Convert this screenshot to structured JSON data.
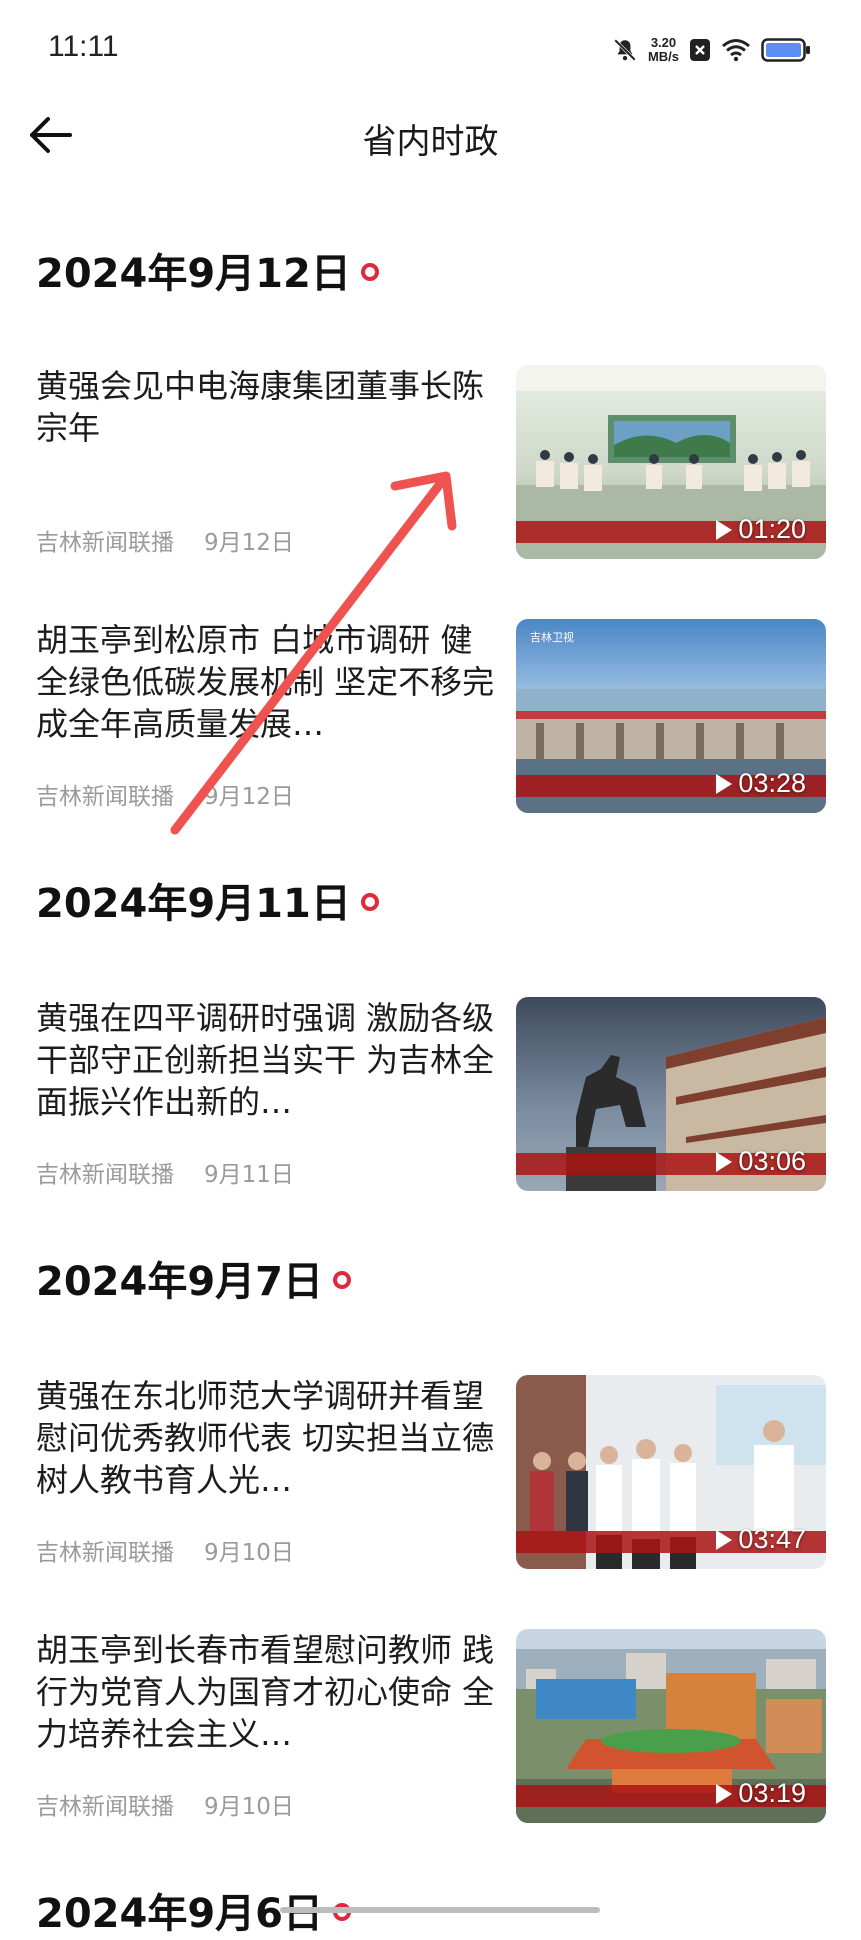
{
  "status_bar": {
    "time": "11:11",
    "net_speed_value": "3.20",
    "net_speed_unit": "MB/s"
  },
  "header": {
    "title": "省内时政",
    "back_icon": "arrow-left-icon"
  },
  "groups": [
    {
      "date": "2024年9月12日",
      "items": [
        {
          "title": "黄强会见中电海康集团董事长陈宗年",
          "source": "吉林新闻联播",
          "date": "9月12日",
          "duration": "01:20"
        },
        {
          "title": "胡玉亭到松原市 白城市调研 健全绿色低碳发展机制 坚定不移完成全年高质量发展…",
          "source": "吉林新闻联播",
          "date": "9月12日",
          "duration": "03:28"
        }
      ]
    },
    {
      "date": "2024年9月11日",
      "items": [
        {
          "title": "黄强在四平调研时强调 激励各级干部守正创新担当实干 为吉林全面振兴作出新的…",
          "source": "吉林新闻联播",
          "date": "9月11日",
          "duration": "03:06"
        }
      ]
    },
    {
      "date": "2024年9月7日",
      "items": [
        {
          "title": "黄强在东北师范大学调研并看望慰问优秀教师代表 切实担当立德树人教书育人光…",
          "source": "吉林新闻联播",
          "date": "9月10日",
          "duration": "03:47"
        },
        {
          "title": "胡玉亭到长春市看望慰问教师 践行为党育人为国育才初心使命 全力培养社会主义…",
          "source": "吉林新闻联播",
          "date": "9月10日",
          "duration": "03:19"
        }
      ]
    },
    {
      "date": "2024年9月6日",
      "items": []
    }
  ],
  "colors": {
    "accent_red": "#e0293a",
    "annotation_arrow": "#ef5350",
    "meta_gray": "#9a9a9a"
  }
}
